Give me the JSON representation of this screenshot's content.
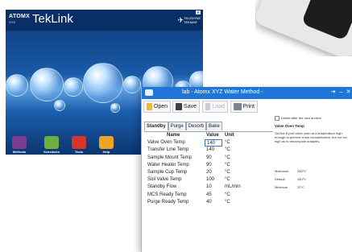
{
  "teklink": {
    "brand": "ATOMX",
    "brand_sub": "XYZ",
    "app_title": "TekLink",
    "vendor_line1": "TELEDYNE",
    "vendor_line2": "TEKMAR",
    "tiles": [
      {
        "label": "Methods",
        "color": "#7a3d8f"
      },
      {
        "label": "Schedules",
        "color": "#6cae3f"
      },
      {
        "label": "Tools",
        "color": "#d6352b"
      },
      {
        "label": "Help",
        "color": "#f0a320"
      }
    ]
  },
  "method_window": {
    "title": "lab - Atomx XYZ  Water Method -",
    "toolbar": {
      "open": "Open",
      "save": "Save",
      "load": "Load",
      "print": "Print"
    },
    "tabs": [
      "Standby",
      "Purge",
      "Desorb",
      "Bake"
    ],
    "active_tab": "Standby",
    "table": {
      "headers": [
        "Name",
        "Value",
        "Unit"
      ],
      "rows": [
        {
          "name": "Valve Oven Temp",
          "value": "140",
          "unit": "°C"
        },
        {
          "name": "Transfer Line Temp",
          "value": "140",
          "unit": "°C"
        },
        {
          "name": "Sample Mount Temp",
          "value": "90",
          "unit": "°C"
        },
        {
          "name": "Water Heater Temp",
          "value": "90",
          "unit": "°C"
        },
        {
          "name": "Sample Cup Temp",
          "value": "20",
          "unit": "°C"
        },
        {
          "name": "Soil Valve Temp",
          "value": "100",
          "unit": "°C"
        },
        {
          "name": "Standby Flow",
          "value": "10",
          "unit": "mL/min"
        },
        {
          "name": "MCS Ready Temp",
          "value": "45",
          "unit": "°C"
        },
        {
          "name": "Purge Ready Temp",
          "value": "40",
          "unit": "°C"
        }
      ]
    },
    "side": {
      "checkbox_label": "Delete after the next archive",
      "heading": "Valve Oven Temp",
      "description": "Set the 8-port valve oven at a temperature high enough to prevent cross contamination, but not too high as to decompose analytes.",
      "limits": [
        {
          "label": "Maximum",
          "value": "250°C"
        },
        {
          "label": "Default",
          "value": "140°C"
        },
        {
          "label": "Minimum",
          "value": "20°C"
        }
      ]
    }
  }
}
